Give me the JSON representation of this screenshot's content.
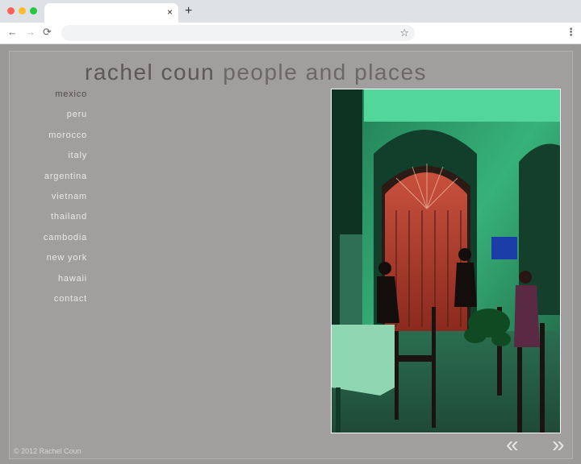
{
  "browser": {
    "tab_close_glyph": "×",
    "new_tab_glyph": "+",
    "back_glyph": "←",
    "forward_glyph": "→",
    "reload_glyph": "⟳",
    "star_glyph": "☆",
    "menu_glyph": "⋮",
    "icons": [
      "close-icon",
      "plus-icon",
      "back-arrow-icon",
      "forward-arrow-icon",
      "reload-icon",
      "star-icon",
      "menu-dots-icon"
    ]
  },
  "site": {
    "name": "rachel coun",
    "subtitle": "people and places",
    "nav": [
      "mexico",
      "peru",
      "morocco",
      "italy",
      "argentina",
      "vietnam",
      "thailand",
      "cambodia",
      "new york",
      "hawaii",
      "contact"
    ],
    "active_nav": "mexico",
    "copyright": "© 2012 Rachel Coun",
    "prev_glyph": "«",
    "next_glyph": "»",
    "colors": {
      "background": "#9b9898",
      "nav_text": "#ebe8e8",
      "nav_active": "#504b4c",
      "title": "#5c5758"
    }
  }
}
